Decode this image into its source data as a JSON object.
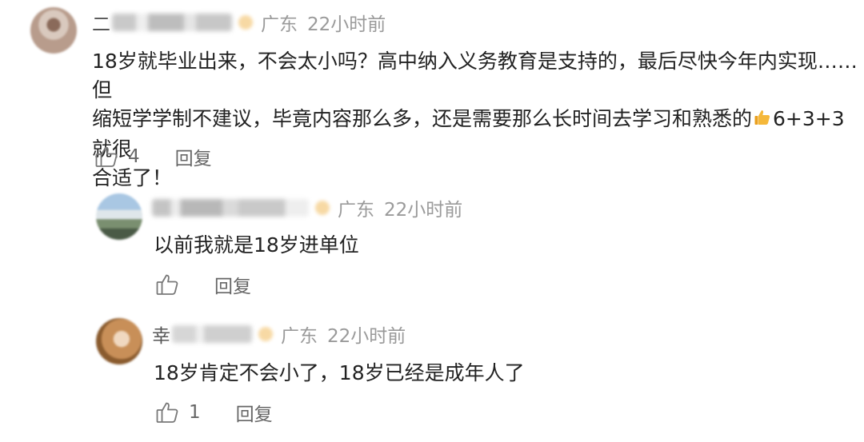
{
  "comments": [
    {
      "name_prefix": "二",
      "location": "广东",
      "time": "22小时前",
      "text_line1_before": "18岁就毕业出来，不会太小吗？高中纳入义务教育是支持的，最后尽快今年内实现……但",
      "text_line2_before": "缩短学学制不建议，毕竟内容那么多，还是需要那么长时间去学习和熟悉的",
      "emoji": "thumbs-up-icon",
      "text_line2_after": "6+3+3就很",
      "text_line3": "合适了！",
      "likes": "4",
      "reply_label": "回复"
    },
    {
      "name_prefix": "",
      "location": "广东",
      "time": "22小时前",
      "text": "以前我就是18岁进单位",
      "likes": "",
      "reply_label": "回复"
    },
    {
      "name_prefix": "幸",
      "location": "广东",
      "time": "22小时前",
      "text": "18岁肯定不会小了，18岁已经是成年人了",
      "likes": "1",
      "reply_label": "回复"
    }
  ],
  "colors": {
    "text": "#222222",
    "meta": "#9a9a9a",
    "action": "#666666",
    "badge": "#f7d9a4"
  }
}
